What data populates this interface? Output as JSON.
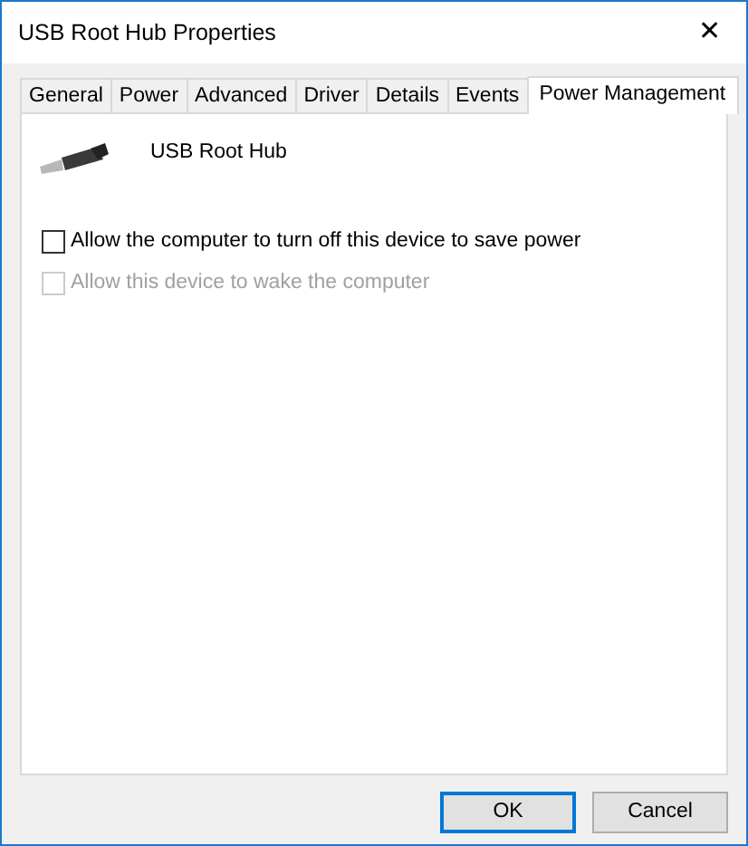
{
  "window": {
    "title": "USB Root Hub Properties",
    "close": "✕"
  },
  "tabs": [
    {
      "label": "General",
      "selected": false
    },
    {
      "label": "Power",
      "selected": false
    },
    {
      "label": "Advanced",
      "selected": false
    },
    {
      "label": "Driver",
      "selected": false
    },
    {
      "label": "Details",
      "selected": false
    },
    {
      "label": "Events",
      "selected": false
    },
    {
      "label": "Power Management",
      "selected": true
    }
  ],
  "device": {
    "name": "USB Root Hub"
  },
  "options": [
    {
      "label": "Allow the computer to turn off this device to save power",
      "checked": false,
      "disabled": false
    },
    {
      "label": "Allow this device to wake the computer",
      "checked": false,
      "disabled": true
    }
  ],
  "buttons": [
    {
      "label": "OK",
      "default": true
    },
    {
      "label": "Cancel",
      "default": false
    }
  ]
}
